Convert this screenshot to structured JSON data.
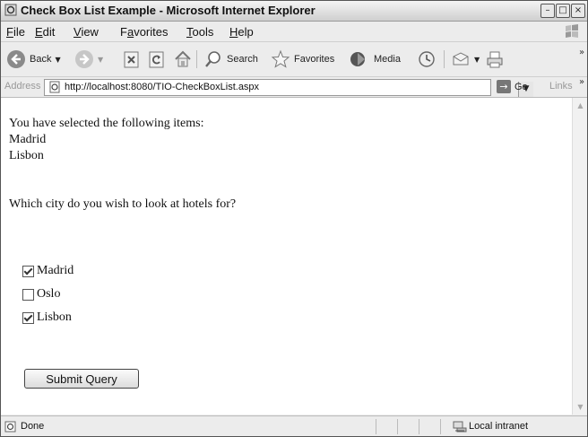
{
  "window": {
    "title": "Check Box List Example - Microsoft Internet Explorer"
  },
  "menu": {
    "items": [
      {
        "label": "File",
        "accel": "F",
        "rest": "ile"
      },
      {
        "label": "Edit",
        "accel": "E",
        "rest": "dit"
      },
      {
        "label": "View",
        "accel": "V",
        "rest": "iew"
      },
      {
        "label": "Favorites",
        "accel": "a",
        "pre": "F",
        "rest": "vorites"
      },
      {
        "label": "Tools",
        "accel": "T",
        "rest": "ools"
      },
      {
        "label": "Help",
        "accel": "H",
        "rest": "elp"
      }
    ]
  },
  "toolbar": {
    "back_label": "Back",
    "search_label": "Search",
    "favorites_label": "Favorites",
    "media_label": "Media"
  },
  "address": {
    "label": "Address",
    "url": "http://localhost:8080/TIO-CheckBoxList.aspx",
    "go_label": "Go",
    "links_label": "Links"
  },
  "page": {
    "selected_heading": "You have selected the following items:",
    "selected_items": [
      "Madrid",
      "Lisbon"
    ],
    "question": "Which city do you wish to look at hotels for?",
    "options": [
      {
        "label": "Madrid",
        "checked": true
      },
      {
        "label": "Oslo",
        "checked": false
      },
      {
        "label": "Lisbon",
        "checked": true
      }
    ],
    "submit_label": "Submit Query"
  },
  "status": {
    "text": "Done",
    "zone": "Local intranet"
  }
}
